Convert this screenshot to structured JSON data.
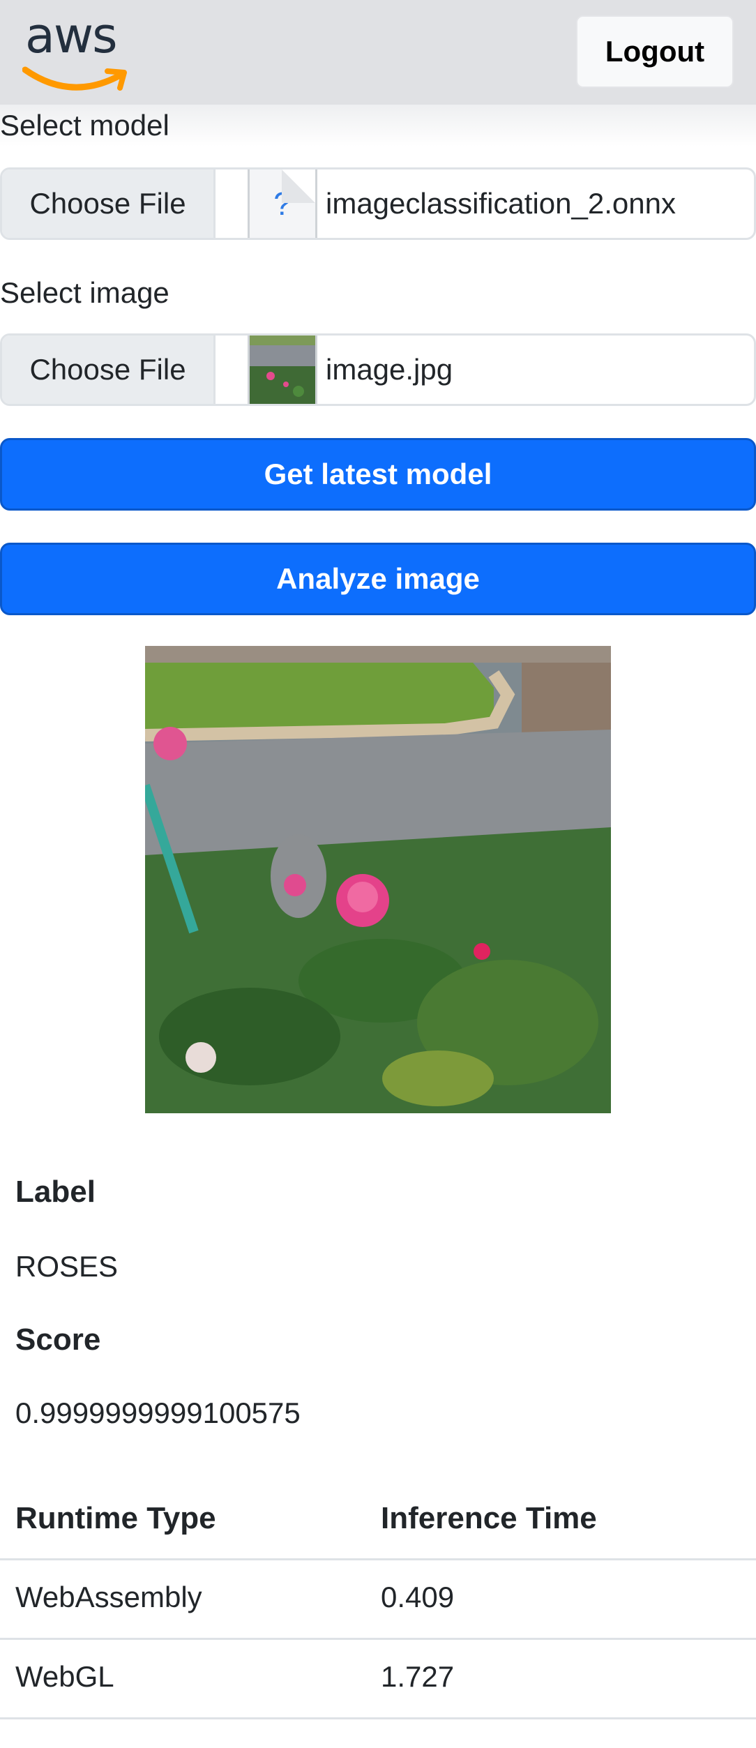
{
  "header": {
    "logo_text": "aws",
    "logout_label": "Logout"
  },
  "model_field": {
    "label": "Select model",
    "button_label": "Choose File",
    "file_icon": "?",
    "file_name": "imageclassification_2.onnx"
  },
  "image_field": {
    "label": "Select image",
    "button_label": "Choose File",
    "file_name": "image.jpg"
  },
  "actions": {
    "get_latest_model": "Get latest model",
    "analyze_image": "Analyze image"
  },
  "result": {
    "label_heading": "Label",
    "label_value": "ROSES",
    "score_heading": "Score",
    "score_value": "0.9999999999100575"
  },
  "table": {
    "headers": [
      "Runtime Type",
      "Inference Time"
    ],
    "rows": [
      [
        "WebAssembly",
        "0.409"
      ],
      [
        "WebGL",
        "1.727"
      ]
    ]
  },
  "colors": {
    "primary": "#0d6efd",
    "header_bg": "#e0e1e4",
    "aws_orange": "#ff9900"
  }
}
